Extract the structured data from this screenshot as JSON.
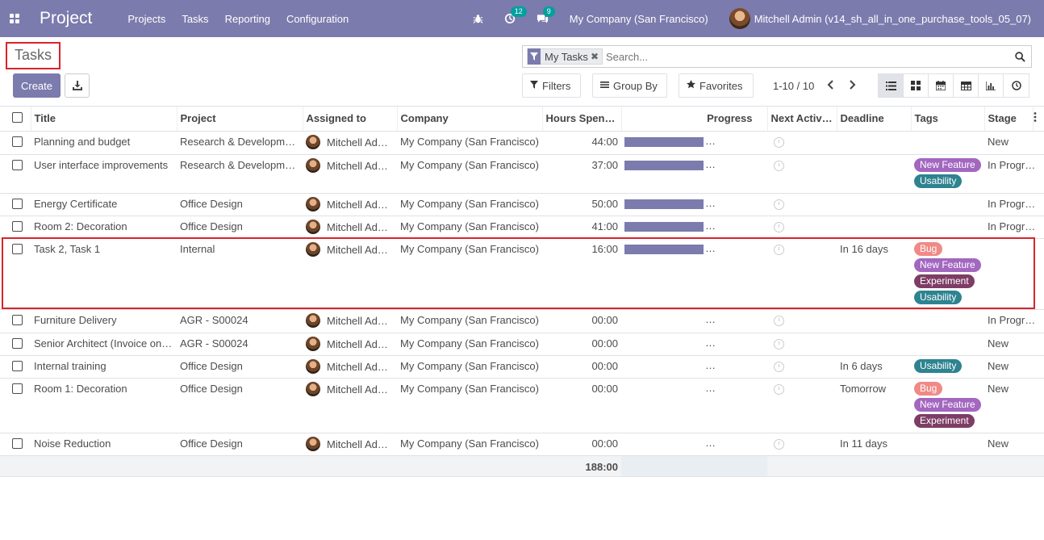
{
  "navbar": {
    "brand": "Project",
    "menu": [
      "Projects",
      "Tasks",
      "Reporting",
      "Configuration"
    ],
    "activity_count": "12",
    "message_count": "9",
    "company": "My Company (San Francisco)",
    "user": "Mitchell Admin (v14_sh_all_in_one_purchase_tools_05_07)"
  },
  "control": {
    "title": "Tasks",
    "create_label": "Create",
    "facet_label": "My Tasks",
    "search_placeholder": "Search...",
    "filters_label": "Filters",
    "groupby_label": "Group By",
    "favorites_label": "Favorites",
    "pager": "1-10 / 10"
  },
  "columns": [
    "Title",
    "Project",
    "Assigned to",
    "Company",
    "Hours Spen…",
    "Progress",
    "Next Activ…",
    "Deadline",
    "Tags",
    "Stage"
  ],
  "rows": [
    {
      "title": "Planning and budget",
      "project": "Research & Development",
      "assigned": "Mitchell Ad…",
      "company": "My Company (San Francisco)",
      "hours": "44:00",
      "progress": 100,
      "deadline": "",
      "tags": [],
      "stage": "New"
    },
    {
      "title": "User interface improvements",
      "project": "Research & Development",
      "assigned": "Mitchell Ad…",
      "company": "My Company (San Francisco)",
      "hours": "37:00",
      "progress": 100,
      "deadline": "",
      "tags": [
        "New Feature",
        "Usability"
      ],
      "stage": "In Progress"
    },
    {
      "title": "Energy Certificate",
      "project": "Office Design",
      "assigned": "Mitchell Ad…",
      "company": "My Company (San Francisco)",
      "hours": "50:00",
      "progress": 100,
      "deadline": "",
      "tags": [],
      "stage": "In Progress"
    },
    {
      "title": "Room 2: Decoration",
      "project": "Office Design",
      "assigned": "Mitchell Ad…",
      "company": "My Company (San Francisco)",
      "hours": "41:00",
      "progress": 100,
      "deadline": "",
      "tags": [],
      "stage": "In Progress"
    },
    {
      "title": "Task 2, Task 1",
      "project": "Internal",
      "assigned": "Mitchell Ad…",
      "company": "My Company (San Francisco)",
      "hours": "16:00",
      "progress": 100,
      "deadline": "In 16 days",
      "tags": [
        "Bug",
        "New Feature",
        "Experiment",
        "Usability"
      ],
      "stage": ""
    },
    {
      "title": "Furniture Delivery",
      "project": "AGR - S00024",
      "assigned": "Mitchell Ad…",
      "company": "My Company (San Francisco)",
      "hours": "00:00",
      "progress": 0,
      "deadline": "",
      "tags": [],
      "stage": "In Progress"
    },
    {
      "title": "Senior Architect (Invoice on…",
      "project": "AGR - S00024",
      "assigned": "Mitchell Ad…",
      "company": "My Company (San Francisco)",
      "hours": "00:00",
      "progress": 0,
      "deadline": "",
      "tags": [],
      "stage": "New"
    },
    {
      "title": "Internal training",
      "project": "Office Design",
      "assigned": "Mitchell Ad…",
      "company": "My Company (San Francisco)",
      "hours": "00:00",
      "progress": 0,
      "deadline": "In 6 days",
      "tags": [
        "Usability"
      ],
      "stage": "New"
    },
    {
      "title": "Room 1: Decoration",
      "project": "Office Design",
      "assigned": "Mitchell Ad…",
      "company": "My Company (San Francisco)",
      "hours": "00:00",
      "progress": 0,
      "deadline": "Tomorrow",
      "tags": [
        "Bug",
        "New Feature",
        "Experiment"
      ],
      "stage": "New"
    },
    {
      "title": "Noise Reduction",
      "project": "Office Design",
      "assigned": "Mitchell Ad…",
      "company": "My Company (San Francisco)",
      "hours": "00:00",
      "progress": 0,
      "deadline": "In 11 days",
      "tags": [],
      "stage": "New"
    }
  ],
  "progress_ellipsis": "…",
  "total_hours": "188:00",
  "tag_colors": {
    "Bug": "#f08a86",
    "New Feature": "#a367c0",
    "Usability": "#2e8390",
    "Experiment": "#7e3d65"
  },
  "accent_color": "#7c7bad"
}
